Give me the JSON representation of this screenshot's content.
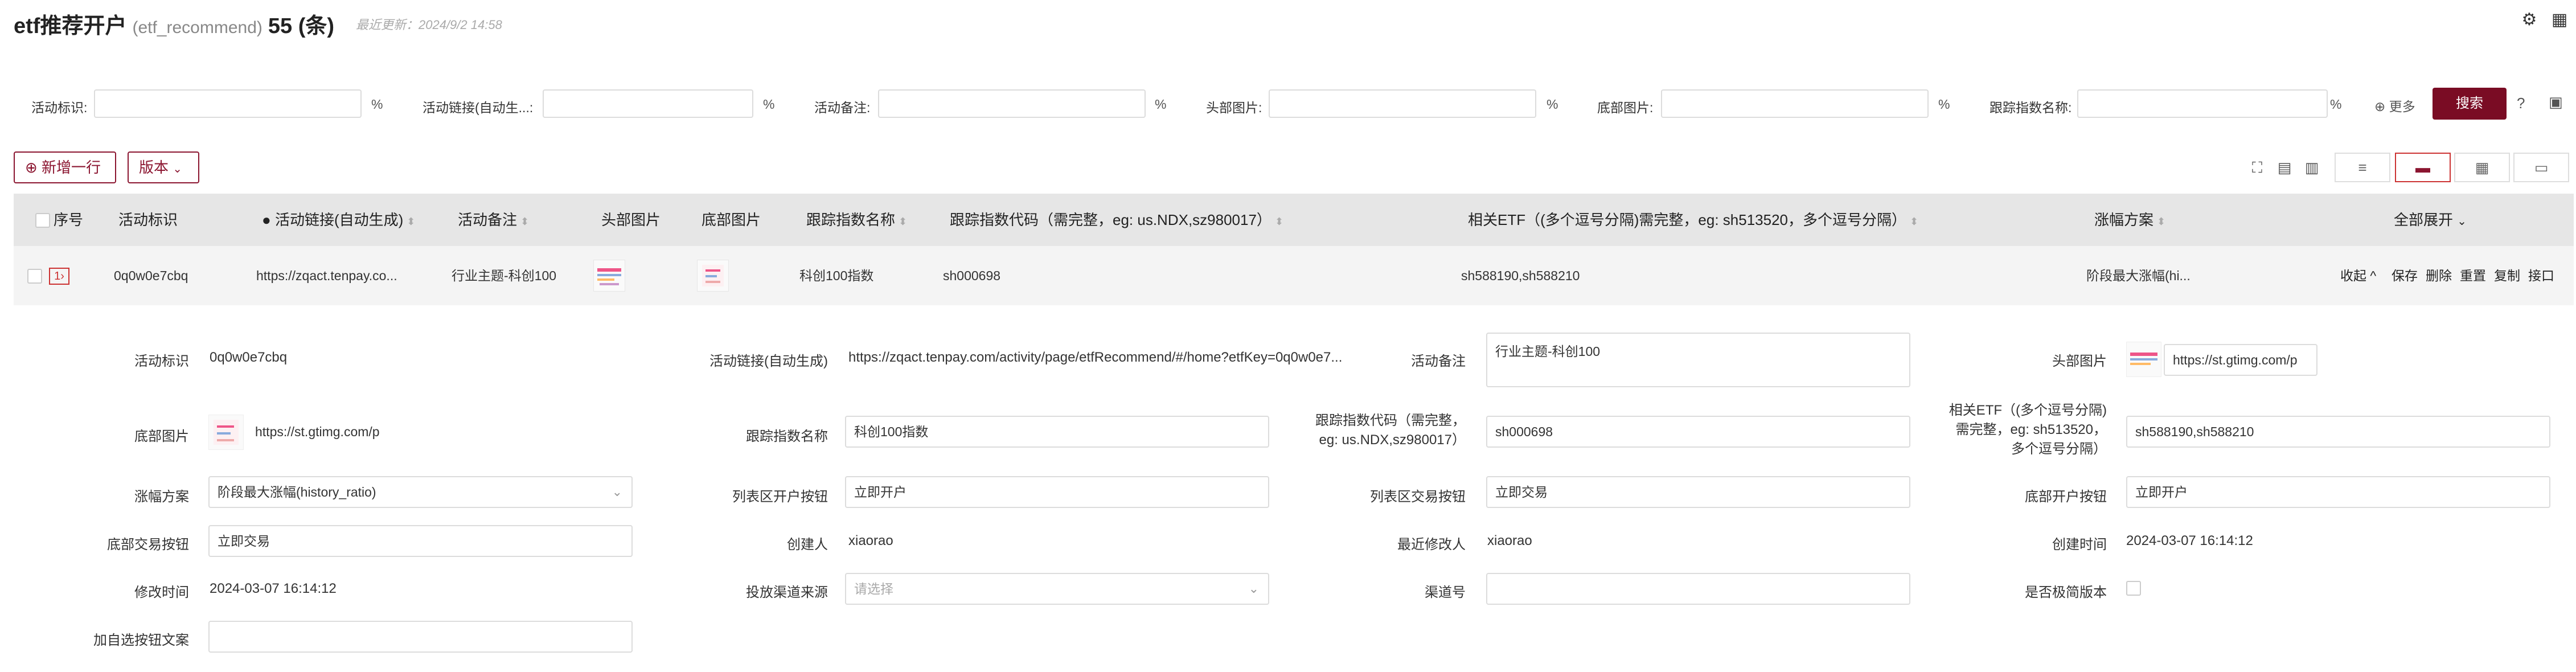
{
  "header": {
    "title": "etf推荐开户",
    "table_name": "(etf_recommend)",
    "count": "55 (条)",
    "updated": "最近更新：2024/9/2 14:58"
  },
  "filters": [
    {
      "label": "活动标识:",
      "pct": "%"
    },
    {
      "label": "活动链接(自动生...:",
      "pct": "%"
    },
    {
      "label": "活动备注:",
      "pct": "%"
    },
    {
      "label": "头部图片:",
      "pct": "%"
    },
    {
      "label": "底部图片:",
      "pct": "%"
    },
    {
      "label": "跟踪指数名称:",
      "pct": "%"
    }
  ],
  "filter_actions": {
    "more": "⊕ 更多",
    "search": "搜索"
  },
  "actions": {
    "add_row": "⊕ 新增一行",
    "version": "版本"
  },
  "table": {
    "columns": [
      "序号",
      "活动标识",
      "活动链接(自动生成)",
      "活动备注",
      "头部图片",
      "底部图片",
      "跟踪指数名称",
      "跟踪指数代码（需完整，eg: us.NDX,sz980017）",
      "相关ETF（(多个逗号分隔)需完整，eg: sh513520，多个逗号分隔）",
      "涨幅方案",
      "全部展开"
    ],
    "row": {
      "index": "1",
      "id": "0q0w0e7cbq",
      "link": "https://zqact.tenpay.co...",
      "note": "行业主题-科创100",
      "index_name": "科创100指数",
      "index_code": "sh000698",
      "etf": "sh588190,sh588210",
      "plan": "阶段最大涨幅(hi...",
      "ops": [
        "收起 ^",
        "保存",
        "删除",
        "重置",
        "复制",
        "接口"
      ]
    }
  },
  "detail": {
    "id_label": "活动标识",
    "id_value": "0q0w0e7cbq",
    "link_label": "活动链接(自动生成)",
    "link_value": "https://zqact.tenpay.com/activity/page/etfRecommend/#/home?etfKey=0q0w0e7...",
    "note_label": "活动备注",
    "note_value": "行业主题-科创100",
    "head_img_label": "头部图片",
    "head_img_value": "https://st.gtimg.com/p",
    "foot_img_label": "底部图片",
    "foot_img_value": "https://st.gtimg.com/p",
    "index_name_label": "跟踪指数名称",
    "index_name_value": "科创100指数",
    "index_code_label_1": "跟踪指数代码（需完整，",
    "index_code_label_2": "eg: us.NDX,sz980017）",
    "index_code_value": "sh000698",
    "etf_label_1": "相关ETF（(多个逗号分隔)",
    "etf_label_2": "需完整，eg: sh513520，",
    "etf_label_3": "多个逗号分隔）",
    "etf_value": "sh588190,sh588210",
    "plan_label": "涨幅方案",
    "plan_value": "阶段最大涨幅(history_ratio)",
    "list_open_label": "列表区开户按钮",
    "list_open_value": "立即开户",
    "list_trade_label": "列表区交易按钮",
    "list_trade_value": "立即交易",
    "foot_open_label": "底部开户按钮",
    "foot_open_value": "立即开户",
    "foot_trade_label": "底部交易按钮",
    "foot_trade_value": "立即交易",
    "creator_label": "创建人",
    "creator_value": "xiaorao",
    "modifier_label": "最近修改人",
    "modifier_value": "xiaorao",
    "created_label": "创建时间",
    "created_value": "2024-03-07 16:14:12",
    "modified_label": "修改时间",
    "modified_value": "2024-03-07 16:14:12",
    "channel_src_label": "投放渠道来源",
    "channel_src_placeholder": "请选择",
    "channel_no_label": "渠道号",
    "simple_label": "是否极简版本",
    "watchlist_label": "加自选按钮文案"
  }
}
